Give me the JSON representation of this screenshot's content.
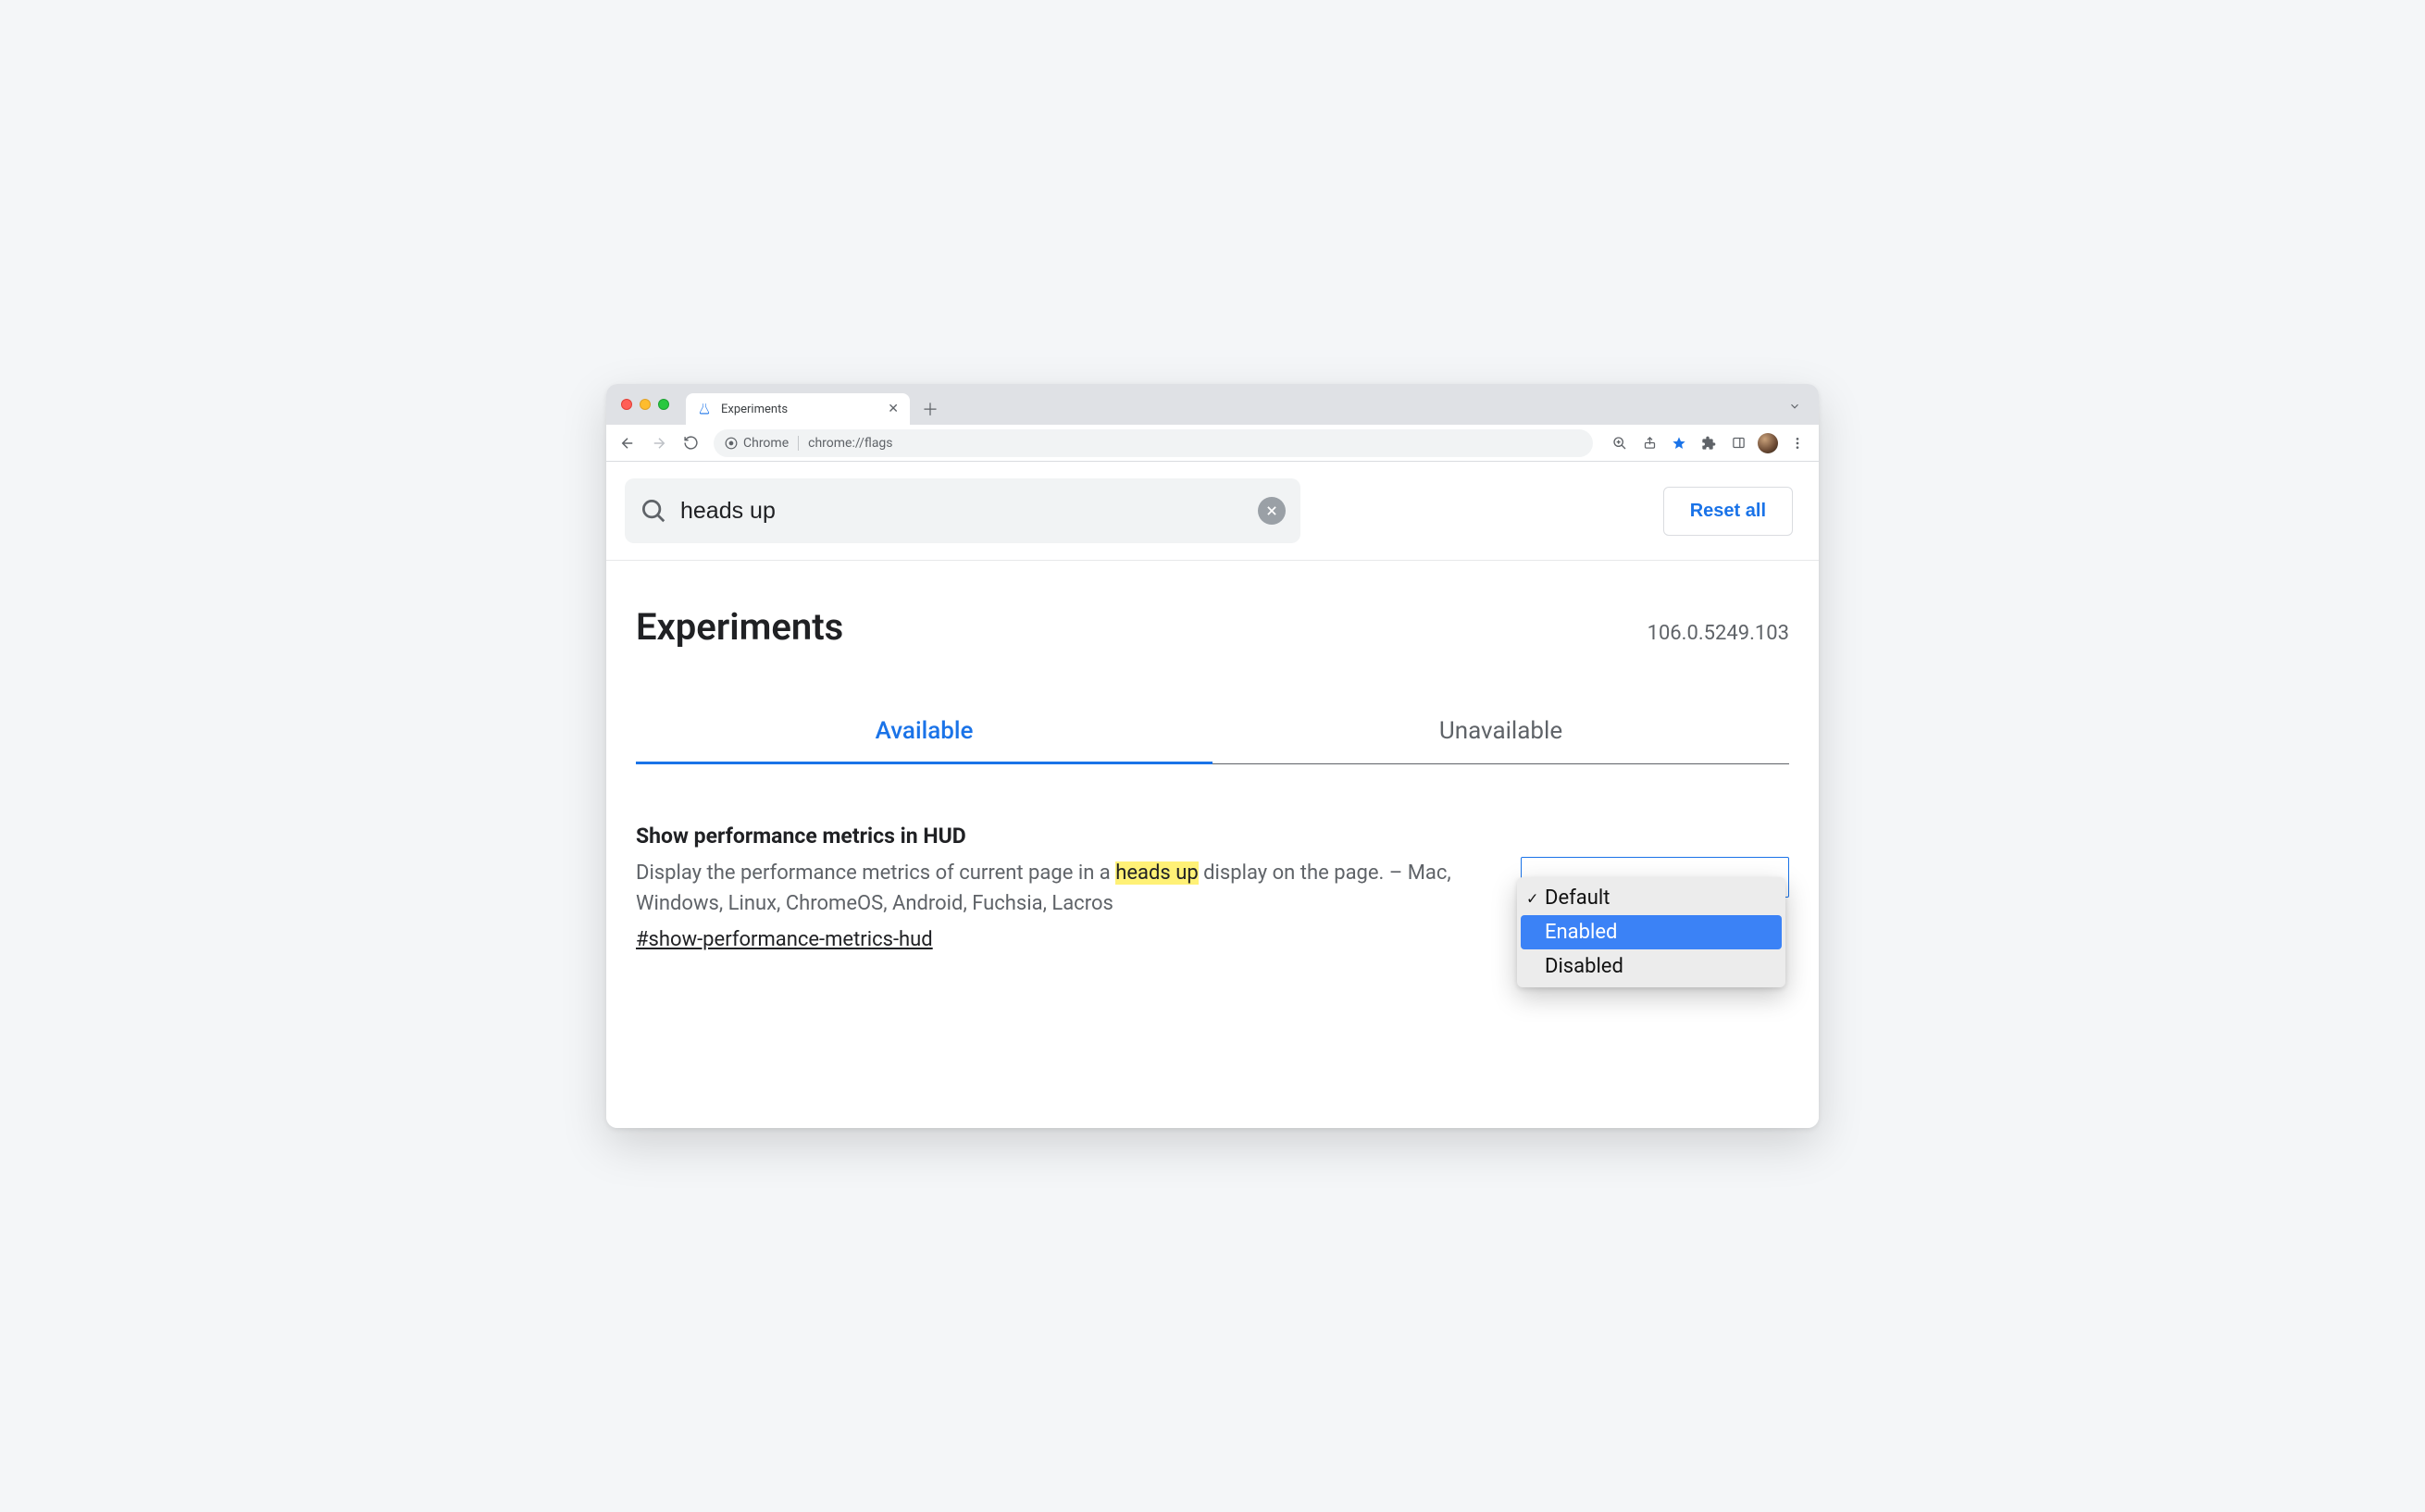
{
  "browser": {
    "tab_title": "Experiments",
    "omnibox_chip": "Chrome",
    "omnibox_url": "chrome://flags"
  },
  "search": {
    "value": "heads up",
    "reset_label": "Reset all"
  },
  "page": {
    "title": "Experiments",
    "version": "106.0.5249.103"
  },
  "tabs": {
    "available": "Available",
    "unavailable": "Unavailable"
  },
  "flag": {
    "title": "Show performance metrics in HUD",
    "desc_before": "Display the performance metrics of current page in a ",
    "desc_highlight": "heads up",
    "desc_after": " display on the page. – Mac, Windows, Linux, ChromeOS, Android, Fuchsia, Lacros",
    "anchor": "#show-performance-metrics-hud"
  },
  "dropdown": {
    "options": [
      "Default",
      "Enabled",
      "Disabled"
    ],
    "current": "Default",
    "highlighted": "Enabled"
  }
}
